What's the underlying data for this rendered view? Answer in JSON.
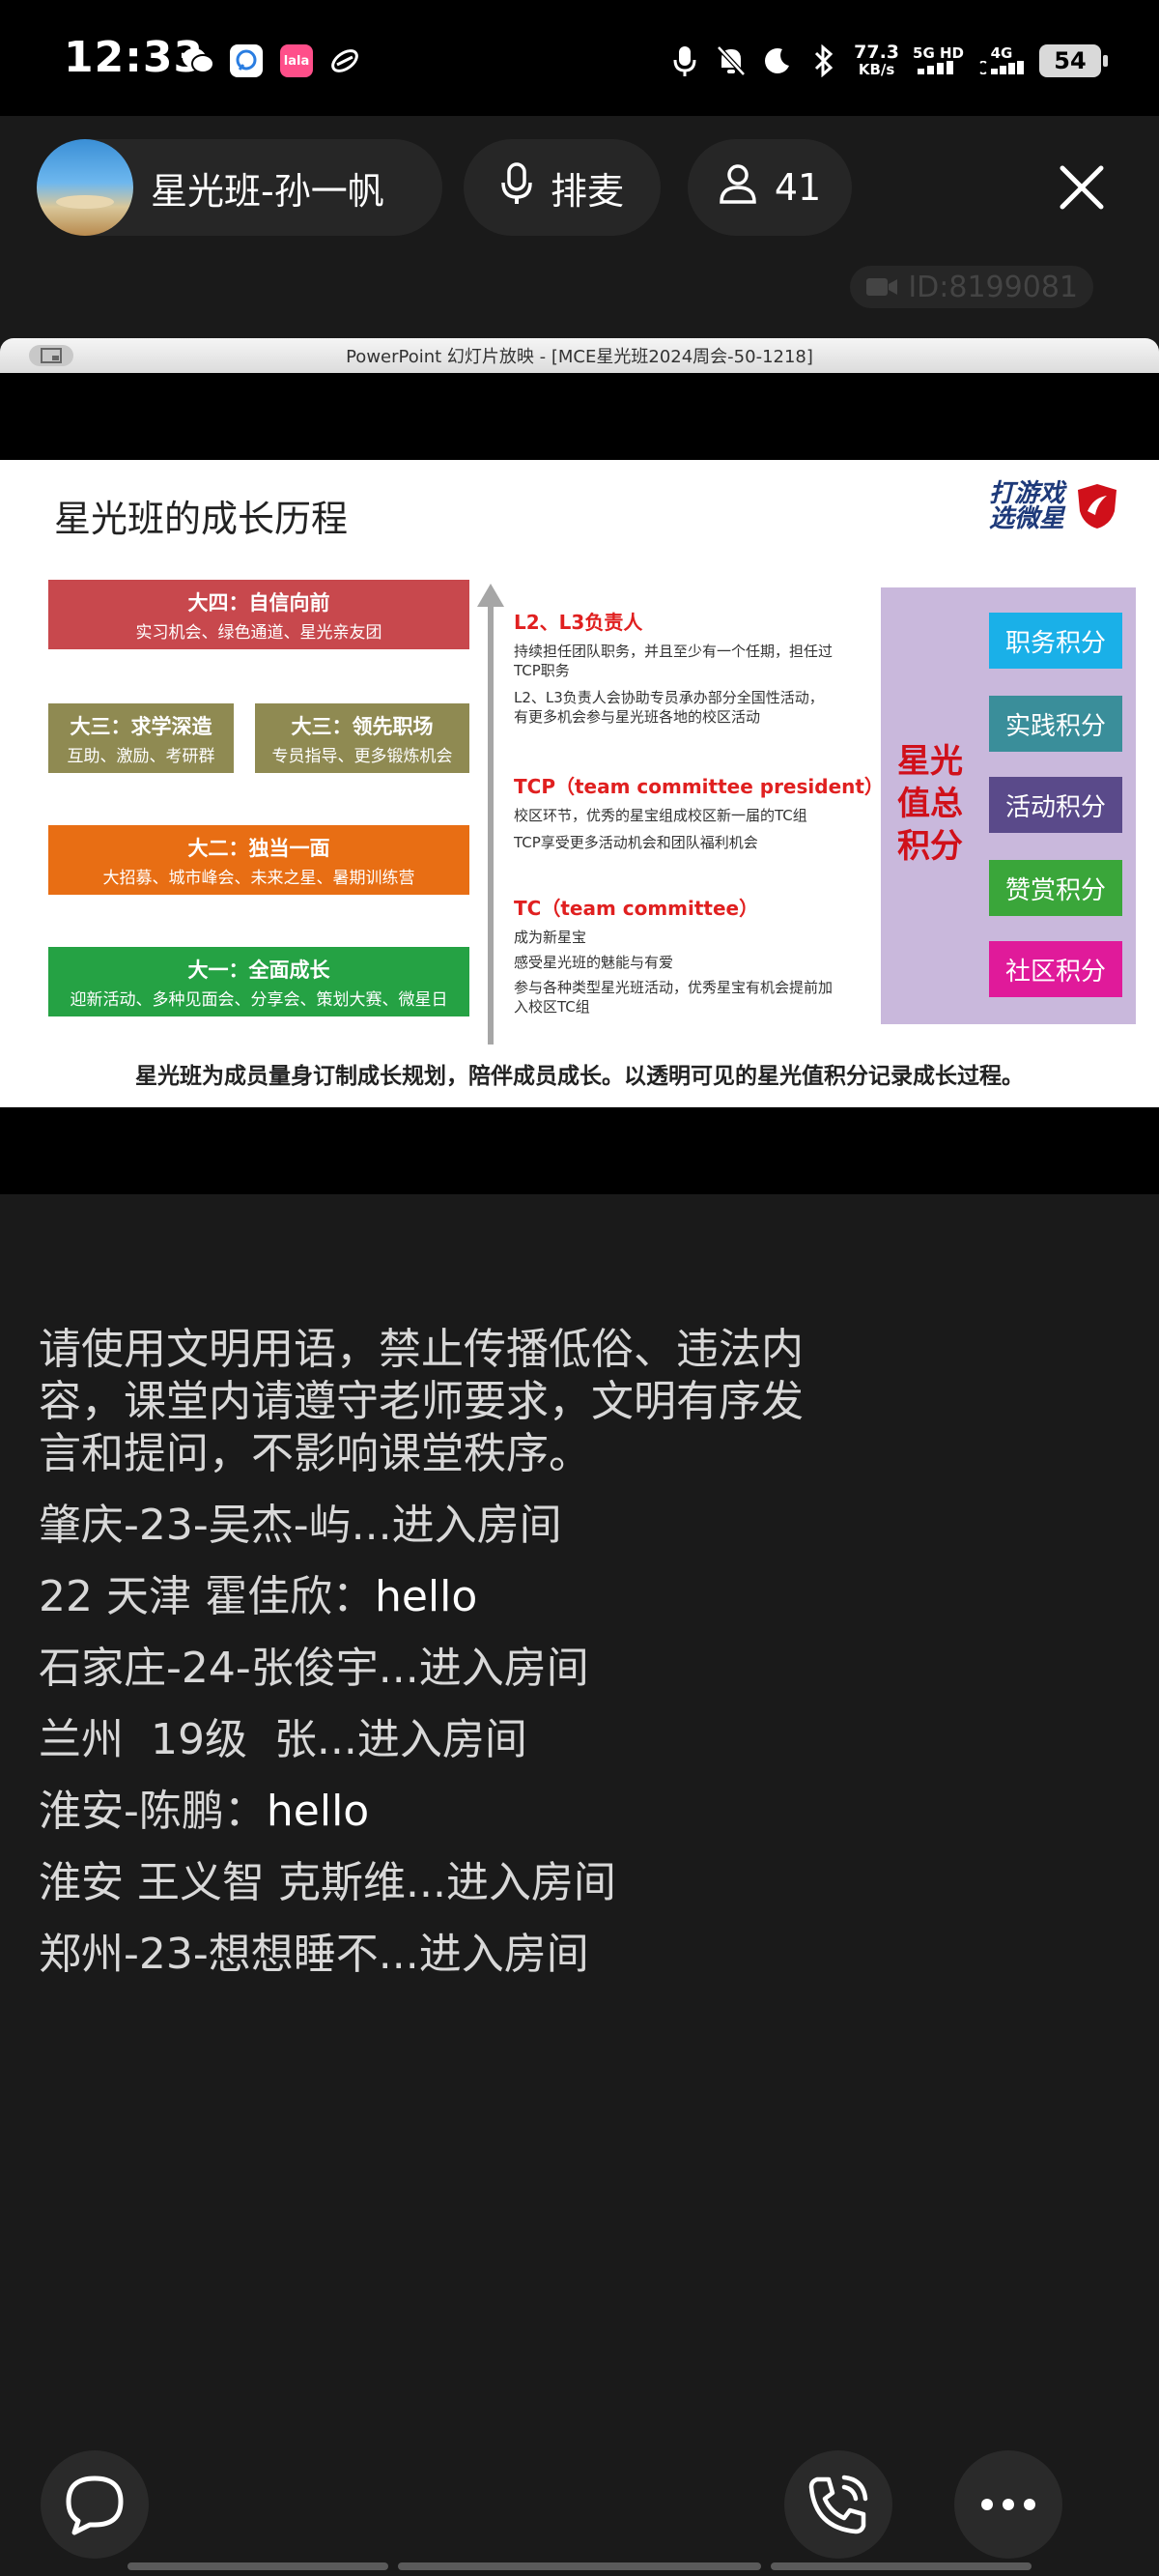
{
  "status_bar": {
    "time": "12:33",
    "app_icons": [
      "wechat-icon",
      "chat-app-icon",
      "lala-app-icon",
      "link-app-icon"
    ],
    "lala_label": "lala",
    "net_speed_value": "77.3",
    "net_speed_unit": "KB/s",
    "sim1": "5G HD",
    "sim2": "4G",
    "battery": "54"
  },
  "header": {
    "host_name": "星光班-孙一帆",
    "queue_label": "排麦",
    "viewer_count": "41",
    "room_id": "ID:8199081"
  },
  "ppt": {
    "window_title": "PowerPoint 幻灯片放映 - [MCE星光班2024周会-50-1218]"
  },
  "slide": {
    "title": "星光班的成长历程",
    "brand_line1": "打游戏",
    "brand_line2": "选微星",
    "stages": [
      {
        "title": "大四：自信向前",
        "sub": "实习机会、绿色通道、星光亲友团",
        "color": "#c8484d"
      },
      {
        "title": "大三：求学深造",
        "sub": "互助、激励、考研群",
        "color": "#8f8a52"
      },
      {
        "title": "大三：领先职场",
        "sub": "专员指导、更多锻炼机会",
        "color": "#8f8a52"
      },
      {
        "title": "大二：独当一面",
        "sub": "大招募、城市峰会、未来之星、暑期训练营",
        "color": "#e86e14"
      },
      {
        "title": "大一：全面成长",
        "sub": "迎新活动、多种见面会、分享会、策划大赛、微星日",
        "color": "#25a244"
      }
    ],
    "roles": [
      {
        "heading": "L2、L3负责人",
        "lines": [
          "持续担任团队职务，并且至少有一个任期，担任过TCP职务",
          "L2、L3负责人会协助专员承办部分全国性活动，有更多机会参与星光班各地的校区活动"
        ]
      },
      {
        "heading": "TCP（team committee president）",
        "lines": [
          "校区环节，优秀的星宝组成校区新一届的TC组",
          "TCP享受更多活动机会和团队福利机会"
        ]
      },
      {
        "heading": "TC（team committee）",
        "lines": [
          "成为新星宝",
          "感受星光班的魅能与有爱",
          "参与各种类型星光班活动，优秀星宝有机会提前加入校区TC组"
        ]
      }
    ],
    "star_label": "星光值总积分",
    "scores": [
      {
        "label": "职务积分",
        "color": "#1ab0e8"
      },
      {
        "label": "实践积分",
        "color": "#3a8e9a"
      },
      {
        "label": "活动积分",
        "color": "#5a4a8a"
      },
      {
        "label": "赞赏积分",
        "color": "#3aa63a"
      },
      {
        "label": "社区积分",
        "color": "#e01a9a"
      }
    ],
    "footer": "星光班为成员量身订制成长规划，陪伴成员成长。以透明可见的星光值积分记录成长过程。"
  },
  "chat": {
    "notice": "请使用文明用语，禁止传播低俗、违法内容，课堂内请遵守老师要求，文明有序发言和提问，不影响课堂秩序。",
    "messages": [
      {
        "user": "肇庆-23-吴杰-屿...",
        "text": "进入房间"
      },
      {
        "user": "22 天津 霍佳欣：",
        "text": "hello"
      },
      {
        "user": "石家庄-24-张俊宇...",
        "text": "进入房间"
      },
      {
        "user": "兰州  19级  张...",
        "text": "进入房间"
      },
      {
        "user": "淮安-陈鹏：",
        "text": "hello"
      },
      {
        "user": "淮安 王义智 克斯维...",
        "text": "进入房间"
      },
      {
        "user": "郑州-23-想想睡不...",
        "text": "进入房间"
      }
    ]
  }
}
